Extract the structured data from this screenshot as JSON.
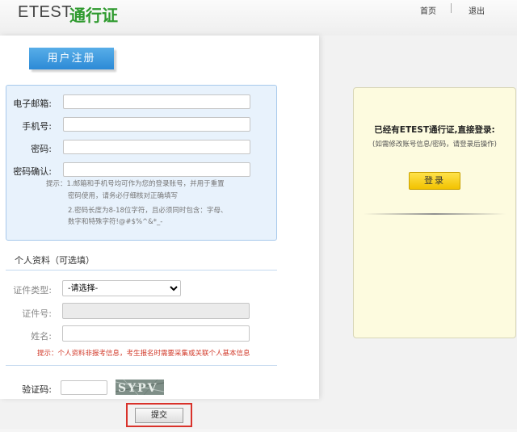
{
  "header": {
    "brand_latin": "ETEST",
    "brand_cn": "通行证",
    "nav": {
      "home": "首页",
      "logout": "退出"
    }
  },
  "registration": {
    "title": "用户注册",
    "fields": {
      "email": {
        "label": "电子邮箱:",
        "value": ""
      },
      "phone": {
        "label": "手机号:",
        "value": ""
      },
      "password": {
        "label": "密码:",
        "value": ""
      },
      "confirm": {
        "label": "密码确认:",
        "value": ""
      }
    },
    "hint_lines": [
      "提示：1.邮箱和手机号均可作为您的登录账号，并用于重置",
      "密码使用，请务必仔细核对正确填写",
      "2.密码长度为8-18位字符，且必须同时包含：字母、",
      "数字和特殊字符!@#$%^&*_-"
    ]
  },
  "personal": {
    "section_title": "个人资料（可选填）",
    "id_type": {
      "label": "证件类型:",
      "selected": "-请选择-"
    },
    "id_number": {
      "label": "证件号:",
      "value": ""
    },
    "name": {
      "label": "姓名:",
      "value": ""
    },
    "hint": "提示：个人资料非报考信息，考生报名时需要采集或关联个人基本信息"
  },
  "captcha": {
    "label": "验证码:",
    "value": "",
    "image_text": "SYPV"
  },
  "submit_label": "提交",
  "login": {
    "title": "已经有ETEST通行证,直接登录:",
    "subtitle": "(如需修改账号信息/密码，请登录后操作)",
    "button": "登录"
  }
}
